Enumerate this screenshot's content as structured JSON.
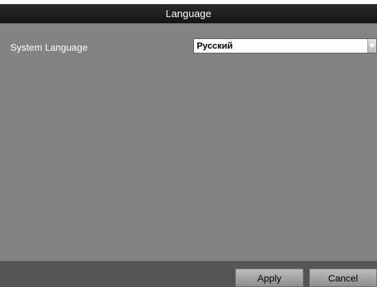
{
  "window": {
    "title": "Language"
  },
  "settings": {
    "system_language_label": "System Language",
    "system_language_value": "Русский"
  },
  "footer": {
    "apply_label": "Apply",
    "cancel_label": "Cancel"
  },
  "icons": {
    "dropdown": "chevron-down-icon"
  }
}
